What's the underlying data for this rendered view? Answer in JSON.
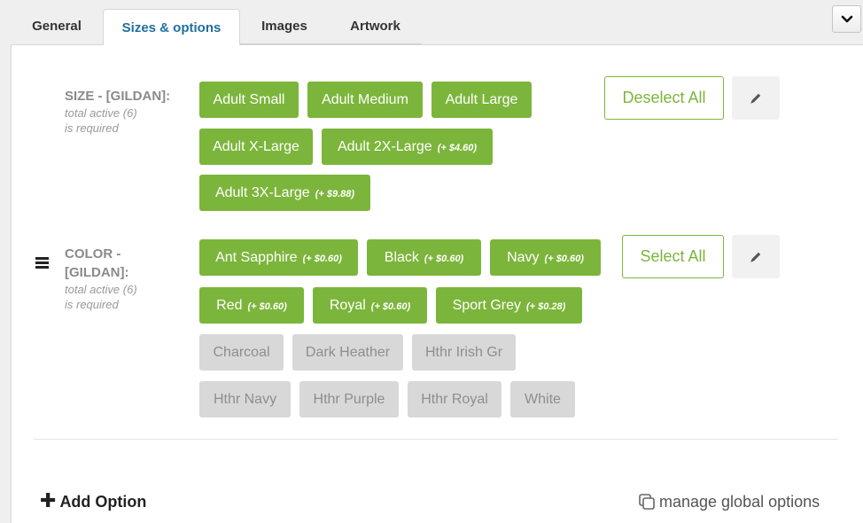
{
  "tabs": [
    {
      "label": "General"
    },
    {
      "label": "Sizes & options"
    },
    {
      "label": "Images"
    },
    {
      "label": "Artwork"
    }
  ],
  "active_tab": "Sizes & options",
  "colors": {
    "accent": "#7cb53b",
    "tab_active_text": "#1f6f9e",
    "chip_inactive_bg": "#d8d8d8",
    "chip_inactive_text": "#8e8e8e"
  },
  "size_option": {
    "title": "SIZE - [GILDAN]:",
    "subtitle1": "total active (6)",
    "subtitle2": "is required",
    "toggle_label": "Deselect All",
    "values": [
      {
        "label": "Adult Small",
        "price": "",
        "active": true
      },
      {
        "label": "Adult Medium",
        "price": "",
        "active": true
      },
      {
        "label": "Adult Large",
        "price": "",
        "active": true
      },
      {
        "label": "Adult X-Large",
        "price": "",
        "active": true
      },
      {
        "label": "Adult 2X-Large",
        "price": "(+ $4.60)",
        "active": true
      },
      {
        "label": "Adult 3X-Large",
        "price": "(+ $9.88)",
        "active": true
      }
    ]
  },
  "color_option": {
    "title_line1": "COLOR -",
    "title_line2": "[GILDAN]:",
    "subtitle1": "total active (6)",
    "subtitle2": "is required",
    "toggle_label": "Select All",
    "values": [
      {
        "label": "Ant Sapphire",
        "price": "(+ $0.60)",
        "active": true
      },
      {
        "label": "Black",
        "price": "(+ $0.60)",
        "active": true
      },
      {
        "label": "Navy",
        "price": "(+ $0.60)",
        "active": true
      },
      {
        "label": "Red",
        "price": "(+ $0.60)",
        "active": true
      },
      {
        "label": "Royal",
        "price": "(+ $0.60)",
        "active": true
      },
      {
        "label": "Sport Grey",
        "price": "(+ $0.28)",
        "active": true
      },
      {
        "label": "Charcoal",
        "price": "",
        "active": false
      },
      {
        "label": "Dark Heather",
        "price": "",
        "active": false
      },
      {
        "label": "Hthr Irish Gr",
        "price": "",
        "active": false
      },
      {
        "label": "Hthr Navy",
        "price": "",
        "active": false
      },
      {
        "label": "Hthr Purple",
        "price": "",
        "active": false
      },
      {
        "label": "Hthr Royal",
        "price": "",
        "active": false
      },
      {
        "label": "White",
        "price": "",
        "active": false
      }
    ]
  },
  "footer": {
    "add_option_label": "Add Option",
    "manage_global_label": "manage global options"
  },
  "icons": {
    "collapse": "chevron-down-icon",
    "edit": "pencil-icon",
    "drag": "hamburger-drag-icon",
    "add": "plus-icon",
    "manage": "copy-icon"
  }
}
